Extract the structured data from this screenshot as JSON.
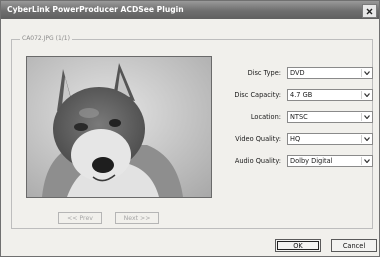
{
  "window": {
    "title": "CyberLink PowerProducer ACDSee Plugin"
  },
  "group": {
    "label": "CA072.JPG (1/1)"
  },
  "fields": [
    {
      "label": "Disc Type:",
      "value": "DVD"
    },
    {
      "label": "Disc Capacity:",
      "value": "4.7 GB"
    },
    {
      "label": "Location:",
      "value": "NTSC"
    },
    {
      "label": "Video Quality:",
      "value": "HQ"
    },
    {
      "label": "Audio Quality:",
      "value": "Dolby Digital"
    }
  ],
  "nav": {
    "prev_label": "<< Prev",
    "next_label": "Next >>"
  },
  "buttons": {
    "ok_label": "OK",
    "cancel_label": "Cancel"
  },
  "colors": {
    "titlebar": "#707070",
    "dialog_bg": "#f1f0ec"
  }
}
